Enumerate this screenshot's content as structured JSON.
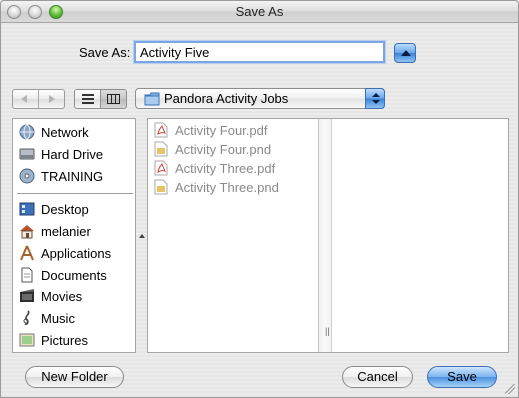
{
  "window": {
    "title": "Save As"
  },
  "save_as": {
    "label": "Save As:",
    "value": "Activity Five"
  },
  "location": {
    "folder": "Pandora Activity Jobs"
  },
  "sidebar": {
    "devices": [
      {
        "label": "Network",
        "icon": "globe-icon"
      },
      {
        "label": "Hard Drive",
        "icon": "hard-drive-icon"
      },
      {
        "label": "TRAINING",
        "icon": "disc-icon"
      }
    ],
    "places": [
      {
        "label": "Desktop",
        "icon": "desktop-icon"
      },
      {
        "label": "melanier",
        "icon": "home-icon"
      },
      {
        "label": "Applications",
        "icon": "applications-icon"
      },
      {
        "label": "Documents",
        "icon": "documents-icon"
      },
      {
        "label": "Movies",
        "icon": "movies-icon"
      },
      {
        "label": "Music",
        "icon": "music-icon"
      },
      {
        "label": "Pictures",
        "icon": "pictures-icon"
      }
    ]
  },
  "files": [
    {
      "name": "Activity Four.pdf",
      "icon": "pdf-file-icon"
    },
    {
      "name": "Activity Four.pnd",
      "icon": "pnd-file-icon"
    },
    {
      "name": "Activity Three.pdf",
      "icon": "pdf-file-icon"
    },
    {
      "name": "Activity Three.pnd",
      "icon": "pnd-file-icon"
    }
  ],
  "buttons": {
    "new_folder": "New Folder",
    "cancel": "Cancel",
    "save": "Save"
  },
  "colors": {
    "accent": "#4b90e0",
    "selection_ring": "#7da5e0"
  }
}
